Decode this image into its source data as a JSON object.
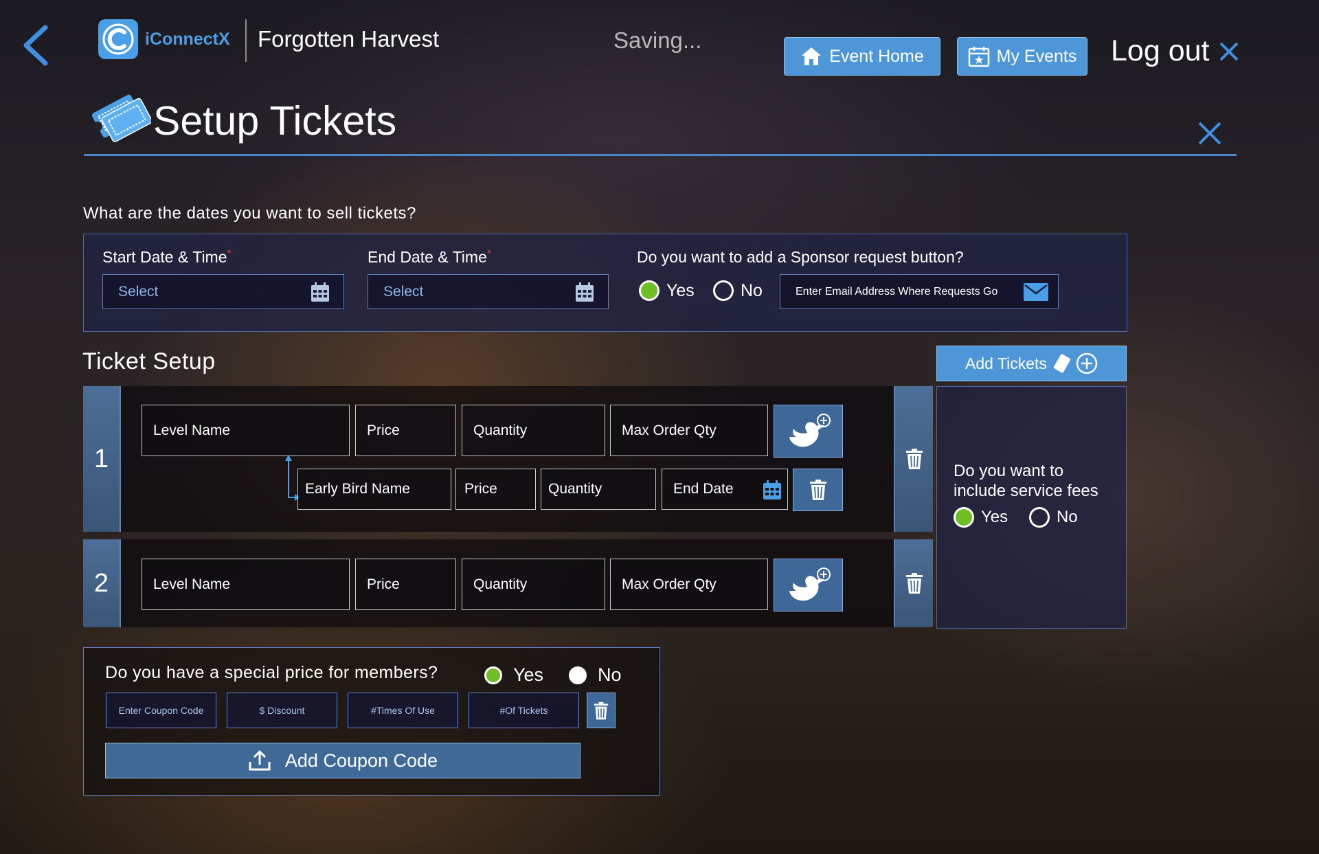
{
  "header": {
    "brand": "iConnectX",
    "event_title": "Forgotten Harvest",
    "status": "Saving...",
    "event_home_label": "Event Home",
    "my_events_label": "My Events",
    "logout_label": "Log out"
  },
  "page": {
    "title": "Setup Tickets"
  },
  "dates_section": {
    "question": "What are the dates you want to sell tickets?",
    "start_label": "Start Date & Time",
    "end_label": "End Date & Time",
    "required_mark": "*",
    "start_value": "Select",
    "end_value": "Select",
    "sponsor_question": "Do you want to add a Sponsor request button?",
    "yes": "Yes",
    "no": "No",
    "sponsor_yes_selected": true,
    "email_placeholder": "Enter Email Address Where Requests Go"
  },
  "ticket_setup": {
    "title": "Ticket Setup",
    "add_tickets_label": "Add Tickets",
    "rows": [
      {
        "number": "1",
        "level_name": "Level Name",
        "price": "Price",
        "quantity": "Quantity",
        "max_order": "Max Order Qty",
        "early_bird": {
          "name": "Early Bird Name",
          "price": "Price",
          "quantity": "Quantity",
          "end_date": "End Date"
        }
      },
      {
        "number": "2",
        "level_name": "Level Name",
        "price": "Price",
        "quantity": "Quantity",
        "max_order": "Max Order Qty"
      }
    ]
  },
  "service_fees": {
    "question": "Do you want to include service fees",
    "yes": "Yes",
    "no": "No",
    "yes_selected": true
  },
  "members": {
    "question": "Do you have a special price for members?",
    "yes": "Yes",
    "no": "No",
    "yes_selected": true,
    "coupon_code": "Enter Coupon Code",
    "discount": "$ Discount",
    "times_of_use": "#Times Of Use",
    "of_tickets": "#Of Tickets",
    "add_coupon_label": "Add Coupon Code"
  },
  "colors": {
    "accent": "#4d96d8",
    "radio_selected": "#6fbf24",
    "required": "#e0413a"
  },
  "icons": [
    "back-chevron-icon",
    "iconnectx-logo-icon",
    "home-icon",
    "calendar-star-icon",
    "close-x-icon",
    "ticket-icon",
    "calendar-icon",
    "mail-icon",
    "bird-add-icon",
    "trash-icon",
    "ticket-plus-icon",
    "upload-icon"
  ]
}
